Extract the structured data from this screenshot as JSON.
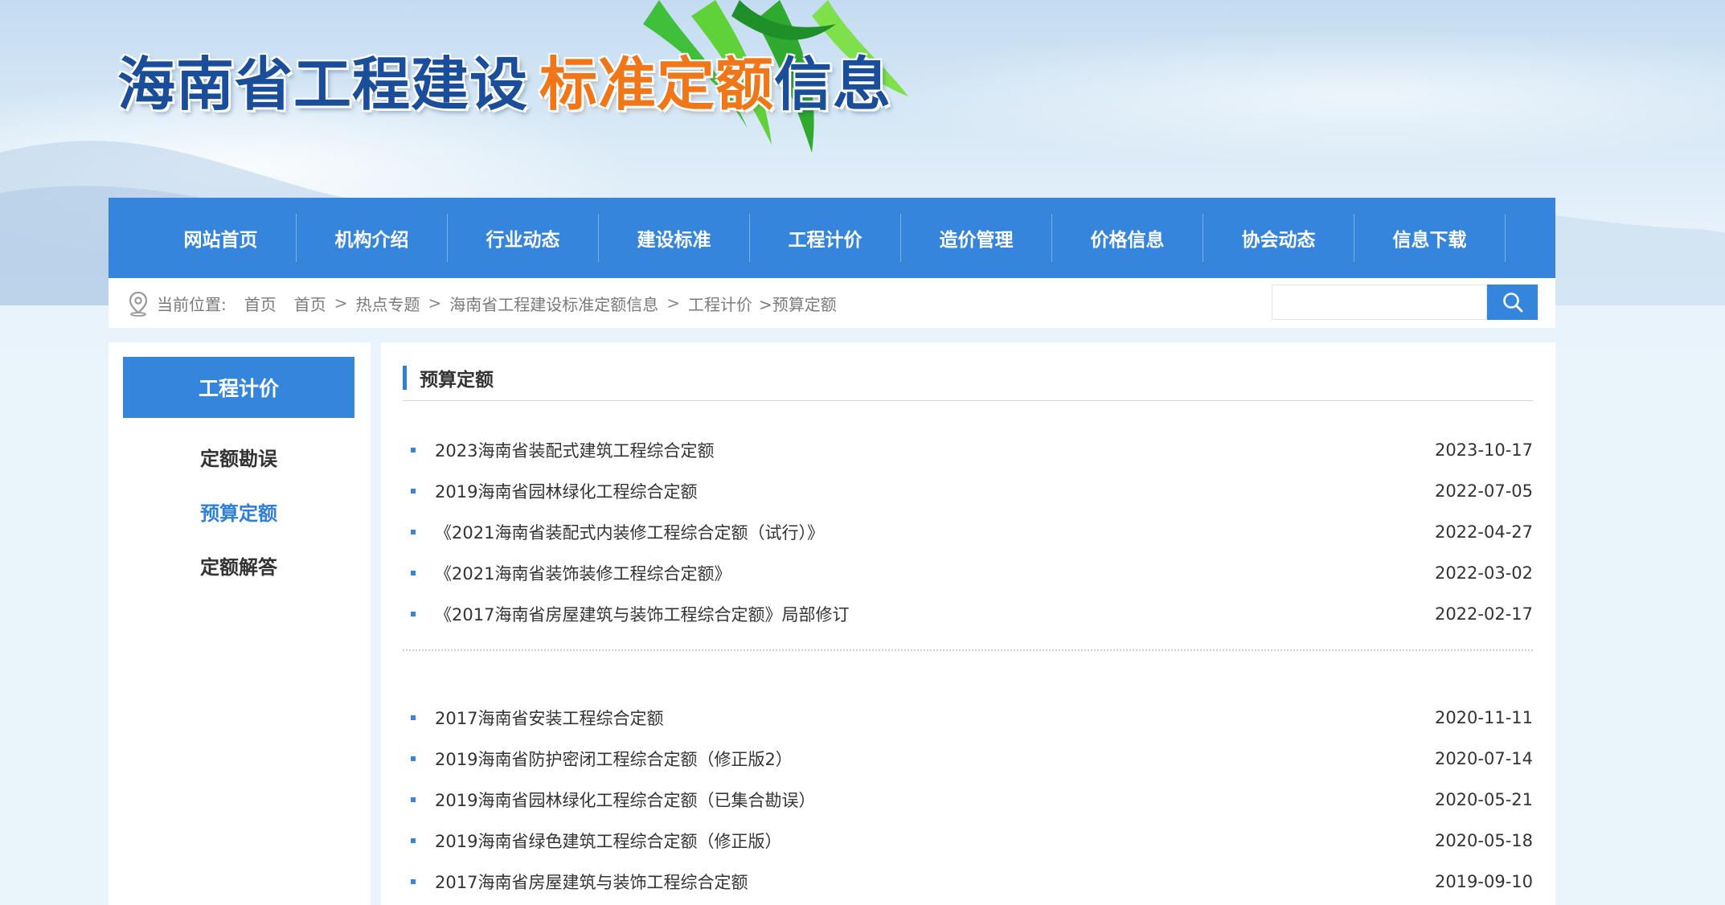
{
  "header": {
    "title_part1": "海南省工程建设",
    "title_part2": "标准定额",
    "title_part3": "信息"
  },
  "nav": {
    "items": [
      {
        "label": "网站首页"
      },
      {
        "label": "机构介绍"
      },
      {
        "label": "行业动态"
      },
      {
        "label": "建设标准"
      },
      {
        "label": "工程计价"
      },
      {
        "label": "造价管理"
      },
      {
        "label": "价格信息"
      },
      {
        "label": "协会动态"
      },
      {
        "label": "信息下载"
      }
    ]
  },
  "breadcrumb": {
    "prefix": "当前位置:",
    "home1": "首页",
    "home2": "首页",
    "sep": ">",
    "item1": "热点专题",
    "item2": "海南省工程建设标准定额信息",
    "item3": "工程计价",
    "current": ">预算定额"
  },
  "search": {
    "placeholder": "",
    "value": ""
  },
  "sidebar": {
    "heading": "工程计价",
    "items": [
      {
        "label": "定额勘误"
      },
      {
        "label": "预算定额"
      },
      {
        "label": "定额解答"
      }
    ]
  },
  "main": {
    "section_title": "预算定额",
    "list_group1": [
      {
        "title": "2023海南省装配式建筑工程综合定额",
        "date": "2023-10-17"
      },
      {
        "title": "2019海南省园林绿化工程综合定额",
        "date": "2022-07-05"
      },
      {
        "title": "《2021海南省装配式内装修工程综合定额（试行）》",
        "date": "2022-04-27"
      },
      {
        "title": "《2021海南省装饰装修工程综合定额》",
        "date": "2022-03-02"
      },
      {
        "title": "《2017海南省房屋建筑与装饰工程综合定额》局部修订",
        "date": "2022-02-17"
      }
    ],
    "list_group2": [
      {
        "title": "2017海南省安装工程综合定额",
        "date": "2020-11-11"
      },
      {
        "title": "2019海南省防护密闭工程综合定额（修正版2）",
        "date": "2020-07-14"
      },
      {
        "title": "2019海南省园林绿化工程综合定额（已集合勘误）",
        "date": "2020-05-21"
      },
      {
        "title": "2019海南省绿色建筑工程综合定额（修正版）",
        "date": "2020-05-18"
      },
      {
        "title": "2017海南省房屋建筑与装饰工程综合定额",
        "date": "2019-09-10"
      }
    ]
  },
  "colors": {
    "accent": "#3585dc",
    "title_blue": "#1b4e9a",
    "title_orange": "#f07617",
    "active_link": "#2f7fd8"
  },
  "icons": {
    "location": "location-pin-icon",
    "search": "search-icon",
    "list_bullet": "square-bullet-icon"
  }
}
